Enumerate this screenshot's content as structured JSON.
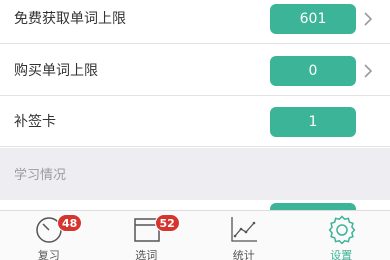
{
  "settings_rows": [
    {
      "label": "免费获取单词上限",
      "value": "601"
    },
    {
      "label": "购买单词上限",
      "value": "0"
    },
    {
      "label": "补签卡",
      "value": "1"
    }
  ],
  "section": {
    "title": "学习情况"
  },
  "tabs": [
    {
      "label": "复习",
      "icon": "clock-icon",
      "badge": "48"
    },
    {
      "label": "选词",
      "icon": "calendar-icon",
      "badge": "52"
    },
    {
      "label": "统计",
      "icon": "chart-icon"
    },
    {
      "label": "设置",
      "icon": "gear-icon",
      "active": true
    }
  ],
  "colors": {
    "accent": "#3cb497",
    "badge": "#d6342f",
    "section_bg": "#eeeef2"
  }
}
